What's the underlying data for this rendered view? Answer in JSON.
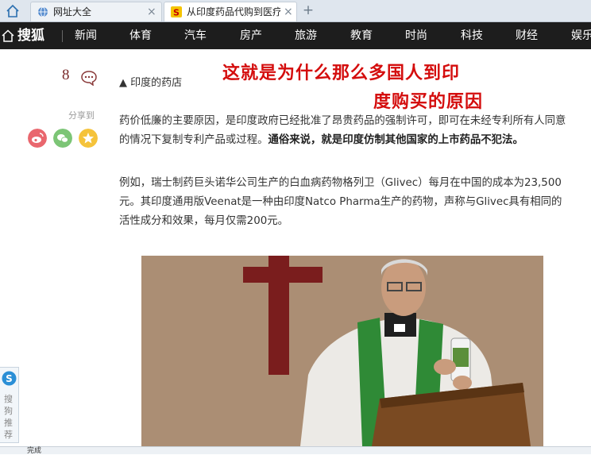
{
  "browser": {
    "tabs": [
      {
        "label": "网址大全",
        "close": "×"
      },
      {
        "label": "从印度药品代购到医疗旅",
        "close": "×"
      }
    ],
    "new_tab": "+"
  },
  "site": {
    "logo": "搜狐",
    "nav": [
      "新闻",
      "体育",
      "汽车",
      "房产",
      "旅游",
      "教育",
      "时尚",
      "科技",
      "财经",
      "娱乐"
    ]
  },
  "article": {
    "comment_count": "8",
    "share_label": "分享到",
    "caption": "▲ 印度的药店",
    "overlay_line1": "这就是为什么那么多国人到印",
    "overlay_line2": "度购买的原因",
    "para1_part1": "药价低廉的主要原因，是印度政府已经批准了昂贵药品的强制许可，即可在未经专利所有人同意的情况下复制专利产品或过程。",
    "para1_bold": "通俗来说，就是印度仿制其他国家的上市药品不犯法。",
    "para2": "例如，瑞士制药巨头诺华公司生产的白血病药物格列卫（Glivec）每月在中国的成本为23,500元。其印度通用版Veenat是一种由印度Natco Pharma生产的药物，声称与Glivec具有相同的活性成分和效果，每月仅需200元。"
  },
  "widget": {
    "text": "搜狗推荐"
  },
  "status": {
    "text": "完成"
  },
  "colors": {
    "nav_bg": "#1d1d1d",
    "overlay_red": "#d40d0d"
  }
}
